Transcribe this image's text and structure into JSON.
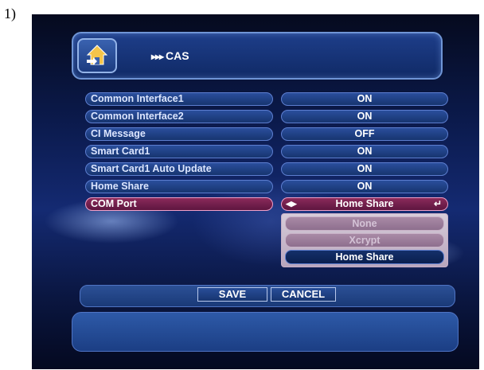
{
  "figure_label": "1)",
  "header": {
    "arrows": "▸▸▸",
    "title": "CAS",
    "icon": "house-arrow-icon"
  },
  "settings": [
    {
      "label": "Common Interface1",
      "value": "ON"
    },
    {
      "label": "Common Interface2",
      "value": "ON"
    },
    {
      "label": "CI Message",
      "value": "OFF"
    },
    {
      "label": "Smart Card1",
      "value": "ON"
    },
    {
      "label": "Smart Card1 Auto Update",
      "value": "ON"
    },
    {
      "label": "Home Share",
      "value": "ON"
    },
    {
      "label": "COM Port",
      "value": "Home Share",
      "selected": true
    }
  ],
  "dropdown": {
    "options": [
      "None",
      "Xcrypt",
      "Home Share"
    ],
    "selected": "Home Share"
  },
  "buttons": {
    "save": "SAVE",
    "cancel": "CANCEL"
  },
  "colors": {
    "selected_row": "#8a2a5a",
    "row_bg": "#2a4e9c",
    "background": "#0b1a4c"
  }
}
